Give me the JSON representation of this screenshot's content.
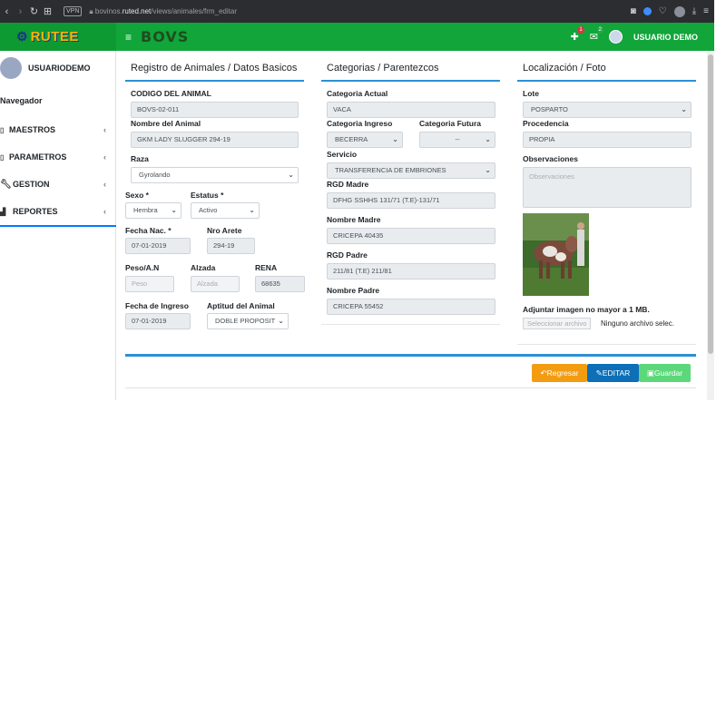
{
  "browser": {
    "url_prefix": "bovinos.",
    "url_domain": "ruted.net",
    "url_path": "/views/animales/frm_editar",
    "vpn_label": "VPN"
  },
  "header": {
    "brand": "RUTEE",
    "app_logo": "BOVS",
    "notif_count": "1",
    "mail_count": "2",
    "user_name": "USUARIO DEMO"
  },
  "sidebar": {
    "username": "USUARIODEMO",
    "nav_header": "Navegador",
    "items": [
      {
        "label": "MAESTROS",
        "icon": "document-icon"
      },
      {
        "label": "PARAMETROS",
        "icon": "document-icon"
      },
      {
        "label": "GESTION",
        "icon": "wrench-icon"
      },
      {
        "label": "REPORTES",
        "icon": "bar-chart-icon"
      }
    ]
  },
  "sections": {
    "basic": "Registro de Animales / Datos Basicos",
    "categories": "Categorias / Parentezcos",
    "location": "Localización / Foto"
  },
  "basic": {
    "codigo_label": "CODIGO DEL ANIMAL",
    "codigo_value": "BOVS-02-011",
    "nombre_label": "Nombre del Animal",
    "nombre_value": "GKM LADY SLUGGER 294-19",
    "raza_label": "Raza",
    "raza_value": "Gyrolando",
    "sexo_label": "Sexo *",
    "sexo_value": "Hembra",
    "estatus_label": "Estatus *",
    "estatus_value": "Activo",
    "fecha_nac_label": "Fecha Nac. *",
    "fecha_nac_value": "07-01-2019",
    "nro_arete_label": "Nro Arete",
    "nro_arete_value": "294-19",
    "peso_label": "Peso/A.N",
    "peso_placeholder": "Peso",
    "alzada_label": "Alzada",
    "alzada_placeholder": "Alzada",
    "rena_label": "RENA",
    "rena_value": "68635",
    "fecha_ingreso_label": "Fecha de Ingreso",
    "fecha_ingreso_value": "07-01-2019",
    "aptitud_label": "Aptitud del Animal",
    "aptitud_value": "DOBLE PROPOSIT"
  },
  "categories": {
    "actual_label": "Categoria Actual",
    "actual_value": "VACA",
    "ingreso_label": "Categoria Ingreso",
    "ingreso_value": "BECERRA",
    "futura_label": "Categoria Futura",
    "futura_value": "--",
    "servicio_label": "Servicio",
    "servicio_value": "TRANSFERENCIA DE EMBRIONES",
    "rgd_madre_label": "RGD Madre",
    "rgd_madre_value": "DFHG SSHHS 131/71 (T.E)-131/71",
    "nombre_madre_label": "Nombre Madre",
    "nombre_madre_value": "CRICEPA 40435",
    "rgd_padre_label": "RGD Padre",
    "rgd_padre_value": "211/81 (T.E) 211/81",
    "nombre_padre_label": "Nombre Padre",
    "nombre_padre_value": "CRICEPA 55452"
  },
  "location": {
    "lote_label": "Lote",
    "lote_value": "POSPARTO",
    "procedencia_label": "Procedencia",
    "procedencia_value": "PROPIA",
    "observaciones_label": "Observaciones",
    "observaciones_placeholder": "Observaciones",
    "upload_label": "Adjuntar imagen no mayor a 1 MB.",
    "file_button": "Seleccionar archivo",
    "file_none": "Ninguno archivo selec."
  },
  "actions": {
    "regresar": "Regresar",
    "editar": "EDITAR",
    "guardar": "Guardar",
    "regresar_color": "#f39c12",
    "editar_color": "#0c6fb8",
    "guardar_color": "#5cd87a"
  }
}
